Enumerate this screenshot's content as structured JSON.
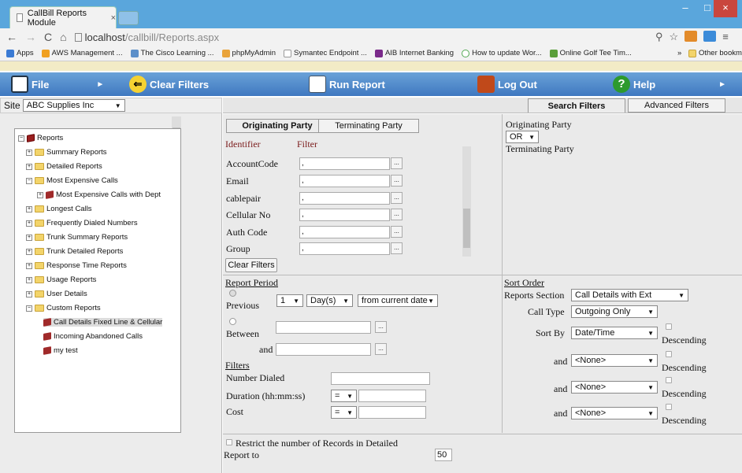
{
  "browser": {
    "tab_title": "CallBill Reports Module",
    "tab_close": "×",
    "url_host": "localhost",
    "url_path": "/callbill/Reports.aspx",
    "window_controls": {
      "minimize": "–",
      "maximize": "□",
      "close": "×"
    },
    "bookmarks": [
      "Apps",
      "AWS Management ...",
      "The Cisco Learning ...",
      "phpMyAdmin",
      "Symantec Endpoint ...",
      "AIB Internet Banking",
      "How to update Wor...",
      "Online Golf Tee Tim..."
    ],
    "bookmarks_more": "»",
    "other_bookmarks": "Other bookmarks"
  },
  "menu": {
    "file": "File",
    "clear_filters": "Clear Filters",
    "run_report": "Run Report",
    "log_out": "Log Out",
    "help": "Help"
  },
  "site": {
    "label": "Site",
    "value": "ABC Supplies Inc"
  },
  "tree": {
    "root": "Reports",
    "items": [
      "Summary Reports",
      "Detailed Reports",
      "Most Expensive Calls",
      "Most Expensive Calls with Dept",
      "Longest Calls",
      "Frequently Dialed Numbers",
      "Trunk Summary Reports",
      "Trunk Detailed Reports",
      "Response Time Reports",
      "Usage Reports",
      "User Details",
      "Custom Reports",
      "Call Details Fixed Line & Cellular",
      "Incoming Abandoned Calls",
      "my test"
    ]
  },
  "top_tabs": {
    "search": "Search Filters",
    "advanced": "Advanced Filters"
  },
  "party_tabs": {
    "originating": "Originating Party",
    "terminating": "Terminating Party"
  },
  "identifier_header": "Identifier",
  "filter_header": "Filter",
  "identifiers": [
    {
      "label": "AccountCode",
      "value": ","
    },
    {
      "label": "Email",
      "value": ","
    },
    {
      "label": "cablepair",
      "value": ","
    },
    {
      "label": "Cellular No",
      "value": ","
    },
    {
      "label": "Auth Code",
      "value": ","
    },
    {
      "label": "Group",
      "value": ","
    }
  ],
  "clear_filters_button": "Clear Filters",
  "logic": {
    "originating": "Originating Party",
    "operator": "OR",
    "terminating": "Terminating Party"
  },
  "report_period": {
    "title": "Report Period",
    "previous": "Previous",
    "previous_count": "1",
    "previous_unit": "Day(s)",
    "previous_from": "from current date",
    "between": "Between",
    "and": "and",
    "dots": "..."
  },
  "filters": {
    "title": "Filters",
    "number_dialed": "Number Dialed",
    "duration": "Duration (hh:mm:ss)",
    "cost": "Cost",
    "operator": "="
  },
  "sort": {
    "title": "Sort Order",
    "reports_section_label": "Reports Section",
    "reports_section_value": "Call Details with Ext",
    "call_type_label": "Call Type",
    "call_type_value": "Outgoing Only",
    "sort_by_label": "Sort By",
    "sort_by_value": "Date/Time",
    "and": "and",
    "none": "<None>",
    "descending": "Descending"
  },
  "restrict": {
    "text": "Restrict the number of Records in Detailed",
    "text2": "Report to",
    "value": "50"
  }
}
